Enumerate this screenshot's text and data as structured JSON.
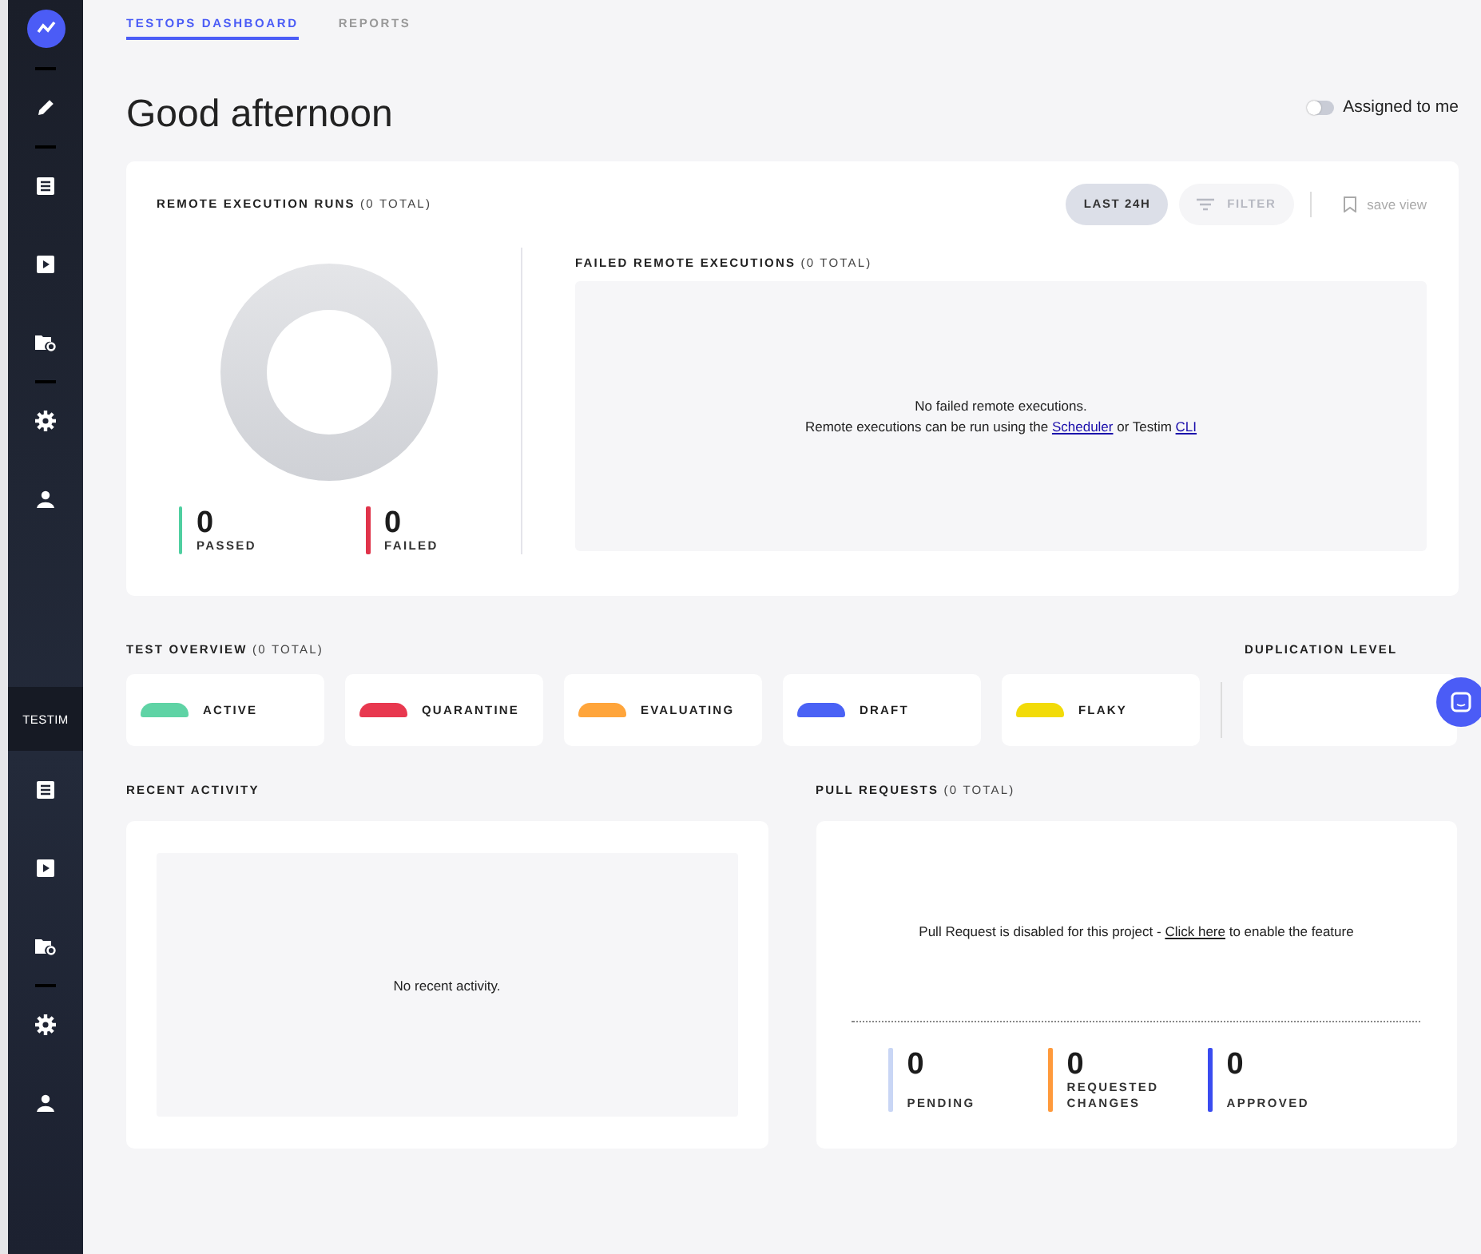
{
  "sidebar": {
    "brand": "TESTIM"
  },
  "tabs": [
    {
      "label": "TESTOPS DASHBOARD",
      "selected": true
    },
    {
      "label": "REPORTS",
      "selected": false
    }
  ],
  "greeting": "Good afternoon",
  "assigned_toggle": {
    "label": "Assigned to me",
    "on": false
  },
  "remote_runs": {
    "title": "REMOTE EXECUTION RUNS",
    "total": "(0 TOTAL)",
    "range_button": "LAST 24H",
    "filter_button": "FILTER",
    "save_view": "save view",
    "stats": [
      {
        "value": "0",
        "label": "PASSED",
        "color": "#4fcfa0"
      },
      {
        "value": "0",
        "label": "FAILED",
        "color": "#e0334a"
      }
    ],
    "failed": {
      "title": "FAILED REMOTE EXECUTIONS",
      "total": "(0 TOTAL)",
      "empty": "No failed remote executions.",
      "hint": [
        {
          "text": "Remote executions can be run using the "
        },
        {
          "link": "Scheduler"
        },
        {
          "text": " or Testim "
        },
        {
          "link": "CLI"
        }
      ]
    }
  },
  "test_overview": {
    "title": "TEST OVERVIEW",
    "total": "(0 TOTAL)",
    "states": [
      {
        "label": "ACTIVE",
        "color": "#5fd3a5"
      },
      {
        "label": "QUARANTINE",
        "color": "#e8384f"
      },
      {
        "label": "EVALUATING",
        "color": "#ffa53b"
      },
      {
        "label": "DRAFT",
        "color": "#4a62f5"
      },
      {
        "label": "FLAKY",
        "color": "#f2db08"
      }
    ]
  },
  "duplication": {
    "title": "DUPLICATION LEVEL"
  },
  "recent_activity": {
    "title": "RECENT ACTIVITY",
    "empty": "No recent activity."
  },
  "pull_requests": {
    "title": "PULL REQUESTS",
    "total": "(0 TOTAL)",
    "message_before": "Pull Request is disabled for this project - ",
    "link": "Click here",
    "message_after": " to enable the feature",
    "stats": [
      {
        "value": "0",
        "label": "PENDING",
        "color": "#c9d6f5"
      },
      {
        "value": "0",
        "label": "REQUESTED CHANGES",
        "color": "#ff9a3c"
      },
      {
        "value": "0",
        "label": "APPROVED",
        "color": "#3a4cf0"
      }
    ]
  }
}
